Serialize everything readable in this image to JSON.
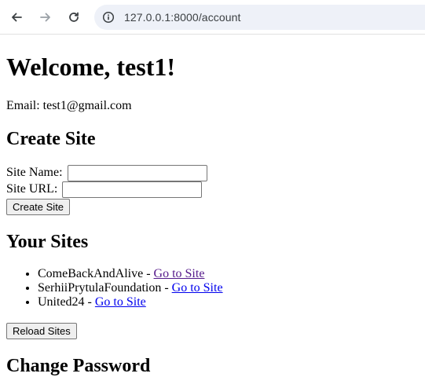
{
  "browser": {
    "url": "127.0.0.1:8000/account"
  },
  "page": {
    "welcome": "Welcome, test1!",
    "email_line": "Email: test1@gmail.com",
    "create_site": {
      "heading": "Create Site",
      "name_label": "Site Name:",
      "name_value": "",
      "url_label": "Site URL:",
      "url_value": "",
      "submit_label": "Create Site"
    },
    "your_sites": {
      "heading": "Your Sites",
      "items": [
        {
          "name": "ComeBackAndAlive",
          "separator": " - ",
          "link": "Go to Site",
          "visited": true
        },
        {
          "name": "SerhiiPrytulaFoundation",
          "separator": " - ",
          "link": "Go to Site",
          "visited": false
        },
        {
          "name": "United24",
          "separator": " - ",
          "link": "Go to Site",
          "visited": false
        }
      ],
      "reload_label": "Reload Sites"
    },
    "change_password": {
      "heading": "Change Password"
    }
  }
}
